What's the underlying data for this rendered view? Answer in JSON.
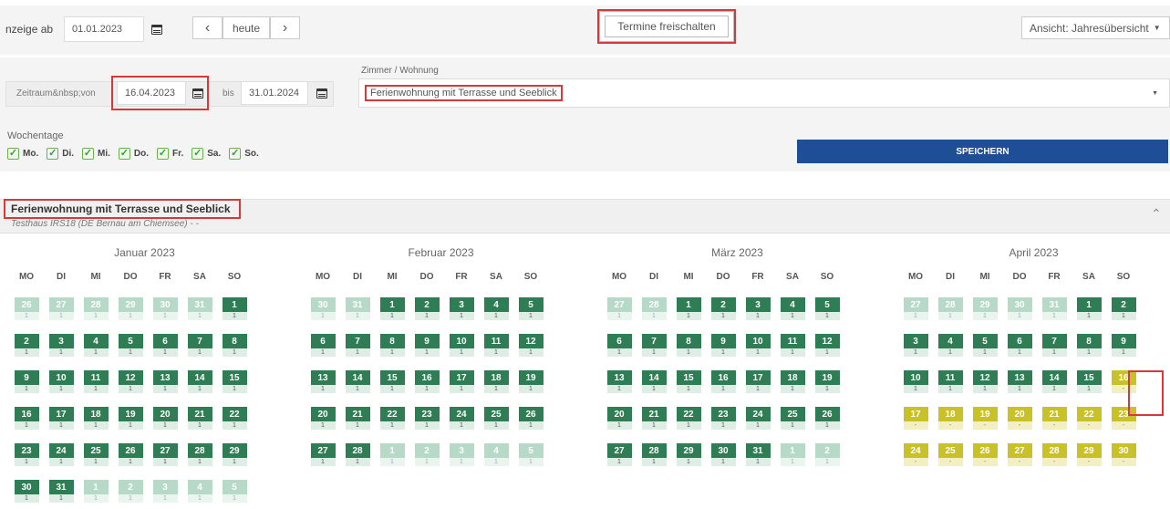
{
  "toolbar": {
    "anzeige_label": "nzeige ab",
    "anzeige_value": "01.01.2023",
    "prev_icon": "chevron-left-icon",
    "today_label": "heute",
    "next_icon": "chevron-right-icon",
    "unlock_button": "Termine freischalten",
    "view_select": "Ansicht: Jahresübersicht"
  },
  "filter": {
    "zeitraum_label": "Zeitraum&nbsp;von",
    "from_value": "16.04.2023",
    "bis_label": "bis",
    "to_value": "31.01.2024",
    "zimmer_label": "Zimmer / Wohnung",
    "zimmer_value": "Ferienwohnung mit Terrasse und Seeblick",
    "wochentage_label": "Wochentage",
    "weekdays": [
      "Mo.",
      "Di.",
      "Mi.",
      "Do.",
      "Fr.",
      "Sa.",
      "So."
    ],
    "save_button": "SPEICHERN"
  },
  "panel": {
    "title": "Ferienwohnung mit Terrasse und Seeblick",
    "subtitle": "Testhaus IRS18 (DE Bernau am Chiemsee) - -"
  },
  "colors": {
    "available": "#2e7d55",
    "outside": "#b7d9c7",
    "blocked": "#c9c128",
    "accent": "#1d4e96",
    "highlight": "#d9383a"
  },
  "dow": [
    "MO",
    "DI",
    "MI",
    "DO",
    "FR",
    "SA",
    "SO"
  ],
  "months": [
    {
      "title": "Januar 2023",
      "weeks": [
        [
          [
            "26",
            "1",
            "f"
          ],
          [
            "27",
            "1",
            "f"
          ],
          [
            "28",
            "1",
            "f"
          ],
          [
            "29",
            "1",
            "f"
          ],
          [
            "30",
            "1",
            "f"
          ],
          [
            "31",
            "1",
            "f"
          ],
          [
            "1",
            "1",
            "g"
          ]
        ],
        [
          [
            "2",
            "1",
            "g"
          ],
          [
            "3",
            "1",
            "g"
          ],
          [
            "4",
            "1",
            "g"
          ],
          [
            "5",
            "1",
            "g"
          ],
          [
            "6",
            "1",
            "g"
          ],
          [
            "7",
            "1",
            "g"
          ],
          [
            "8",
            "1",
            "g"
          ]
        ],
        [
          [
            "9",
            "1",
            "g"
          ],
          [
            "10",
            "1",
            "g"
          ],
          [
            "11",
            "1",
            "g"
          ],
          [
            "12",
            "1",
            "g"
          ],
          [
            "13",
            "1",
            "g"
          ],
          [
            "14",
            "1",
            "g"
          ],
          [
            "15",
            "1",
            "g"
          ]
        ],
        [
          [
            "16",
            "1",
            "g"
          ],
          [
            "17",
            "1",
            "g"
          ],
          [
            "18",
            "1",
            "g"
          ],
          [
            "19",
            "1",
            "g"
          ],
          [
            "20",
            "1",
            "g"
          ],
          [
            "21",
            "1",
            "g"
          ],
          [
            "22",
            "1",
            "g"
          ]
        ],
        [
          [
            "23",
            "1",
            "g"
          ],
          [
            "24",
            "1",
            "g"
          ],
          [
            "25",
            "1",
            "g"
          ],
          [
            "26",
            "1",
            "g"
          ],
          [
            "27",
            "1",
            "g"
          ],
          [
            "28",
            "1",
            "g"
          ],
          [
            "29",
            "1",
            "g"
          ]
        ],
        [
          [
            "30",
            "1",
            "g"
          ],
          [
            "31",
            "1",
            "g"
          ],
          [
            "1",
            "1",
            "f"
          ],
          [
            "2",
            "1",
            "f"
          ],
          [
            "3",
            "1",
            "f"
          ],
          [
            "4",
            "1",
            "f"
          ],
          [
            "5",
            "1",
            "f"
          ]
        ]
      ]
    },
    {
      "title": "Februar 2023",
      "weeks": [
        [
          [
            "30",
            "1",
            "f"
          ],
          [
            "31",
            "1",
            "f"
          ],
          [
            "1",
            "1",
            "g"
          ],
          [
            "2",
            "1",
            "g"
          ],
          [
            "3",
            "1",
            "g"
          ],
          [
            "4",
            "1",
            "g"
          ],
          [
            "5",
            "1",
            "g"
          ]
        ],
        [
          [
            "6",
            "1",
            "g"
          ],
          [
            "7",
            "1",
            "g"
          ],
          [
            "8",
            "1",
            "g"
          ],
          [
            "9",
            "1",
            "g"
          ],
          [
            "10",
            "1",
            "g"
          ],
          [
            "11",
            "1",
            "g"
          ],
          [
            "12",
            "1",
            "g"
          ]
        ],
        [
          [
            "13",
            "1",
            "g"
          ],
          [
            "14",
            "1",
            "g"
          ],
          [
            "15",
            "1",
            "g"
          ],
          [
            "16",
            "1",
            "g"
          ],
          [
            "17",
            "1",
            "g"
          ],
          [
            "18",
            "1",
            "g"
          ],
          [
            "19",
            "1",
            "g"
          ]
        ],
        [
          [
            "20",
            "1",
            "g"
          ],
          [
            "21",
            "1",
            "g"
          ],
          [
            "22",
            "1",
            "g"
          ],
          [
            "23",
            "1",
            "g"
          ],
          [
            "24",
            "1",
            "g"
          ],
          [
            "25",
            "1",
            "g"
          ],
          [
            "26",
            "1",
            "g"
          ]
        ],
        [
          [
            "27",
            "1",
            "g"
          ],
          [
            "28",
            "1",
            "g"
          ],
          [
            "1",
            "1",
            "f"
          ],
          [
            "2",
            "1",
            "f"
          ],
          [
            "3",
            "1",
            "f"
          ],
          [
            "4",
            "1",
            "f"
          ],
          [
            "5",
            "1",
            "f"
          ]
        ]
      ]
    },
    {
      "title": "März 2023",
      "weeks": [
        [
          [
            "27",
            "1",
            "f"
          ],
          [
            "28",
            "1",
            "f"
          ],
          [
            "1",
            "1",
            "g"
          ],
          [
            "2",
            "1",
            "g"
          ],
          [
            "3",
            "1",
            "g"
          ],
          [
            "4",
            "1",
            "g"
          ],
          [
            "5",
            "1",
            "g"
          ]
        ],
        [
          [
            "6",
            "1",
            "g"
          ],
          [
            "7",
            "1",
            "g"
          ],
          [
            "8",
            "1",
            "g"
          ],
          [
            "9",
            "1",
            "g"
          ],
          [
            "10",
            "1",
            "g"
          ],
          [
            "11",
            "1",
            "g"
          ],
          [
            "12",
            "1",
            "g"
          ]
        ],
        [
          [
            "13",
            "1",
            "g"
          ],
          [
            "14",
            "1",
            "g"
          ],
          [
            "15",
            "1",
            "g"
          ],
          [
            "16",
            "1",
            "g"
          ],
          [
            "17",
            "1",
            "g"
          ],
          [
            "18",
            "1",
            "g"
          ],
          [
            "19",
            "1",
            "g"
          ]
        ],
        [
          [
            "20",
            "1",
            "g"
          ],
          [
            "21",
            "1",
            "g"
          ],
          [
            "22",
            "1",
            "g"
          ],
          [
            "23",
            "1",
            "g"
          ],
          [
            "24",
            "1",
            "g"
          ],
          [
            "25",
            "1",
            "g"
          ],
          [
            "26",
            "1",
            "g"
          ]
        ],
        [
          [
            "27",
            "1",
            "g"
          ],
          [
            "28",
            "1",
            "g"
          ],
          [
            "29",
            "1",
            "g"
          ],
          [
            "30",
            "1",
            "g"
          ],
          [
            "31",
            "1",
            "g"
          ],
          [
            "1",
            "1",
            "f"
          ],
          [
            "2",
            "1",
            "f"
          ]
        ]
      ]
    },
    {
      "title": "April 2023",
      "weeks": [
        [
          [
            "27",
            "1",
            "f"
          ],
          [
            "28",
            "1",
            "f"
          ],
          [
            "29",
            "1",
            "f"
          ],
          [
            "30",
            "1",
            "f"
          ],
          [
            "31",
            "1",
            "f"
          ],
          [
            "1",
            "1",
            "g"
          ],
          [
            "2",
            "1",
            "g"
          ]
        ],
        [
          [
            "3",
            "1",
            "g"
          ],
          [
            "4",
            "1",
            "g"
          ],
          [
            "5",
            "1",
            "g"
          ],
          [
            "6",
            "1",
            "g"
          ],
          [
            "7",
            "1",
            "g"
          ],
          [
            "8",
            "1",
            "g"
          ],
          [
            "9",
            "1",
            "g"
          ]
        ],
        [
          [
            "10",
            "1",
            "g"
          ],
          [
            "11",
            "1",
            "g"
          ],
          [
            "12",
            "1",
            "g"
          ],
          [
            "13",
            "1",
            "g"
          ],
          [
            "14",
            "1",
            "g"
          ],
          [
            "15",
            "1",
            "g"
          ],
          [
            "16",
            "-",
            "y"
          ]
        ],
        [
          [
            "17",
            "-",
            "y"
          ],
          [
            "18",
            "-",
            "y"
          ],
          [
            "19",
            "-",
            "y"
          ],
          [
            "20",
            "-",
            "y"
          ],
          [
            "21",
            "-",
            "y"
          ],
          [
            "22",
            "-",
            "y"
          ],
          [
            "23",
            "-",
            "y"
          ]
        ],
        [
          [
            "24",
            "-",
            "y"
          ],
          [
            "25",
            "-",
            "y"
          ],
          [
            "26",
            "-",
            "y"
          ],
          [
            "27",
            "-",
            "y"
          ],
          [
            "28",
            "-",
            "y"
          ],
          [
            "29",
            "-",
            "y"
          ],
          [
            "30",
            "-",
            "y"
          ]
        ]
      ]
    }
  ]
}
